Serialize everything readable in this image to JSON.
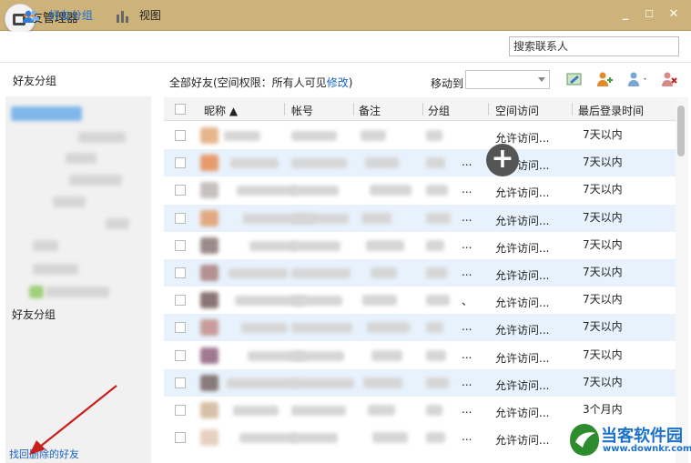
{
  "window": {
    "title": "友管理器",
    "min_glyph": "_",
    "max_glyph": "☐",
    "close_glyph": "✕"
  },
  "toolbar": {
    "groups_label": "好友分组",
    "view_label": "视图",
    "search_placeholder": "搜索联系人"
  },
  "sidebar": {
    "header": "好友分组",
    "group_label": "好友分组",
    "recover_link": "找回删除的好友"
  },
  "main": {
    "heading_prefix": "全部好友(空间权限：所有人可见",
    "heading_link": "修改",
    "heading_suffix": ")",
    "moveto_label": "移动到",
    "moveto_value": ""
  },
  "table": {
    "columns": [
      "昵称 ▲",
      "帐号",
      "备注",
      "分组",
      "空间访问",
      "最后登录时间"
    ],
    "rows": [
      {
        "access": "允许访问...",
        "last_login": "7天以内",
        "dots": "",
        "alt": false
      },
      {
        "access": "允许访问...",
        "last_login": "7天以内",
        "dots": "...",
        "alt": true
      },
      {
        "access": "允许访问...",
        "last_login": "7天以内",
        "dots": "...",
        "alt": false
      },
      {
        "access": "允许访问...",
        "last_login": "7天以内",
        "dots": "...",
        "alt": true
      },
      {
        "access": "允许访问...",
        "last_login": "7天以内",
        "dots": "...",
        "alt": false
      },
      {
        "access": "允许访问...",
        "last_login": "7天以内",
        "dots": "...",
        "alt": true
      },
      {
        "access": "允许访问...",
        "last_login": "7天以内",
        "dots": "、",
        "alt": false
      },
      {
        "access": "允许访问...",
        "last_login": "7天以内",
        "dots": "...",
        "alt": true
      },
      {
        "access": "允许访问...",
        "last_login": "7天以内",
        "dots": "...",
        "alt": false
      },
      {
        "access": "允许访问...",
        "last_login": "7天以内",
        "dots": "...",
        "alt": true
      },
      {
        "access": "允许访问...",
        "last_login": "3个月内",
        "dots": "...",
        "alt": false
      },
      {
        "access": "允许访问...",
        "last_login": "",
        "dots": "...",
        "alt": false
      }
    ]
  },
  "watermark": {
    "brand": "当客软件园",
    "url": "www.downkr.com"
  },
  "colors": {
    "titlebar": "#cdb27a",
    "link": "#1a62c2",
    "alt_row": "#e8f2fc",
    "arrow": "#c81e1e"
  },
  "icons": {
    "groups": "friends-icon",
    "view": "bar-chart-icon",
    "overlay": "plus-circle-icon"
  }
}
